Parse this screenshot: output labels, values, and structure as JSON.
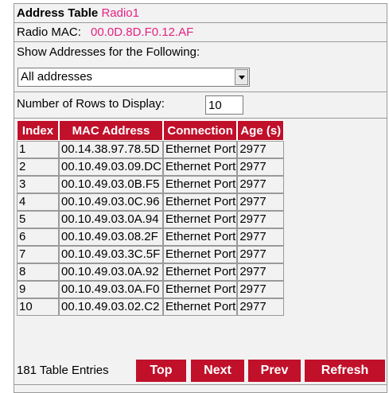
{
  "header": {
    "title": "Address Table",
    "radio": "Radio1",
    "mac_label": "Radio MAC:",
    "mac_value": "00.0D.8D.F0.12.AF"
  },
  "filter": {
    "label": "Show Addresses for the Following:",
    "selected": "All addresses"
  },
  "rows_display": {
    "label": "Number of Rows to Display:",
    "value": "10"
  },
  "table": {
    "columns": [
      "Index",
      "MAC Address",
      "Connection",
      "Age (s)"
    ],
    "rows": [
      [
        "1",
        "00.14.38.97.78.5D",
        "Ethernet Port",
        "2977"
      ],
      [
        "2",
        "00.10.49.03.09.DC",
        "Ethernet Port",
        "2977"
      ],
      [
        "3",
        "00.10.49.03.0B.F5",
        "Ethernet Port",
        "2977"
      ],
      [
        "4",
        "00.10.49.03.0C.96",
        "Ethernet Port",
        "2977"
      ],
      [
        "5",
        "00.10.49.03.0A.94",
        "Ethernet Port",
        "2977"
      ],
      [
        "6",
        "00.10.49.03.08.2F",
        "Ethernet Port",
        "2977"
      ],
      [
        "7",
        "00.10.49.03.3C.5F",
        "Ethernet Port",
        "2977"
      ],
      [
        "8",
        "00.10.49.03.0A.92",
        "Ethernet Port",
        "2977"
      ],
      [
        "9",
        "00.10.49.03.0A.F0",
        "Ethernet Port",
        "2977"
      ],
      [
        "10",
        "00.10.49.03.02.C2",
        "Ethernet Port",
        "2977"
      ]
    ]
  },
  "footer": {
    "entries": "181 Table Entries",
    "buttons": {
      "top": "Top",
      "next": "Next",
      "prev": "Prev",
      "refresh": "Refresh"
    }
  },
  "colors": {
    "accent": "#c0102a",
    "highlight": "#e52283",
    "panel_bg": "#f2f2f2"
  }
}
